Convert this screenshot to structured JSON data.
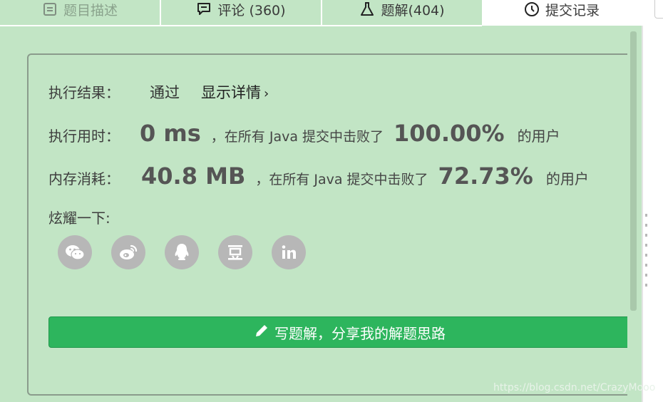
{
  "tabs": [
    {
      "label": "题目描述",
      "icon": "document-icon"
    },
    {
      "label": "评论 (360)",
      "icon": "comment-icon"
    },
    {
      "label": "题解(404)",
      "icon": "flask-icon"
    },
    {
      "label": "提交记录",
      "icon": "clock-icon"
    }
  ],
  "result": {
    "status_label": "执行结果：",
    "status_value": "通过",
    "details_link": "显示详情",
    "time_label": "执行用时：",
    "time_value": "0 ms",
    "time_mid": "，在所有 Java 提交中击败了",
    "time_pct": "100.00%",
    "time_tail": "的用户",
    "mem_label": "内存消耗：",
    "mem_value": "40.8 MB",
    "mem_mid": "，在所有 Java 提交中击败了",
    "mem_pct": "72.73%",
    "mem_tail": "的用户",
    "share_label": "炫耀一下:"
  },
  "share_icons": [
    "wechat-icon",
    "weibo-icon",
    "qq-icon",
    "douban-icon",
    "linkedin-icon"
  ],
  "write_button": "写题解，分享我的解题思路",
  "watermark": "https://blog.csdn.net/CrazyMooo",
  "colors": {
    "background": "#c2e5c5",
    "button_green": "#2db55d",
    "share_icon_bg": "#b7b7b7"
  }
}
